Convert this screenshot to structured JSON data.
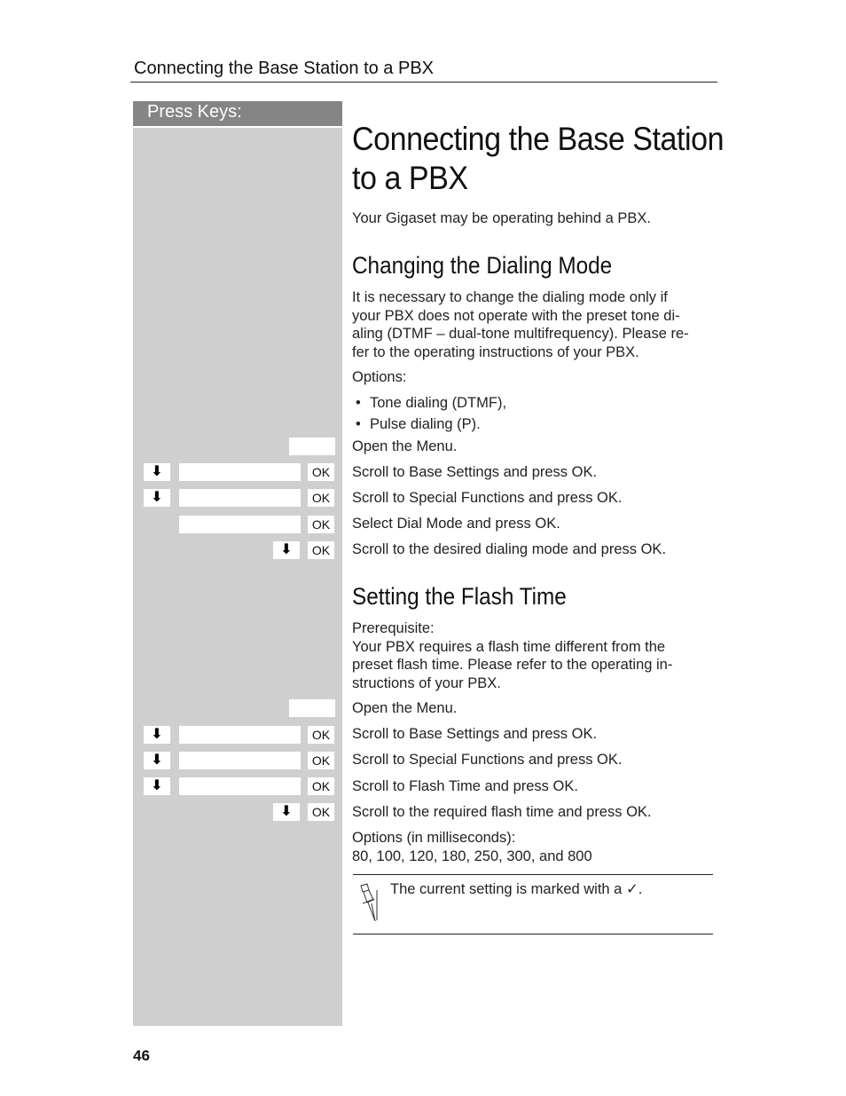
{
  "running_header": "Connecting the Base Station to a PBX",
  "press_keys_label": "Press Keys:",
  "title_line1": "Connecting the Base Station",
  "title_line2": "to a PBX",
  "intro": "Your Gigaset may be operating behind a PBX.",
  "section1": {
    "heading": "Changing the Dialing Mode",
    "body": [
      "It is necessary to change the dialing mode only if",
      "your PBX does not operate with the preset tone di-",
      "aling (DTMF – dual-tone multifrequency). Please re-",
      "fer to the operating instructions of your PBX."
    ],
    "options_label": "Options:",
    "options": [
      "Tone dialing (DTMF),",
      "Pulse dialing (P)."
    ],
    "steps": [
      {
        "keys": [
          "menu"
        ],
        "text": "Open the Menu."
      },
      {
        "keys": [
          "arrow-down",
          "display",
          "ok"
        ],
        "text": "Scroll to Base Settings and press OK."
      },
      {
        "keys": [
          "arrow-down",
          "display",
          "ok"
        ],
        "text": "Scroll to Special Functions and press OK."
      },
      {
        "keys": [
          "display",
          "ok"
        ],
        "text": "Select Dial Mode and press OK."
      },
      {
        "keys": [
          "arrow-down",
          "ok"
        ],
        "text": "Scroll to the desired dialing mode and press OK."
      }
    ]
  },
  "section2": {
    "heading": "Setting the Flash Time",
    "prereq_label": "Prerequisite:",
    "prereq_body": [
      "Your PBX requires a flash time different from the",
      "preset flash time. Please refer to the operating in-",
      "structions of your PBX."
    ],
    "steps": [
      {
        "keys": [
          "menu"
        ],
        "text": "Open the Menu."
      },
      {
        "keys": [
          "arrow-down",
          "display",
          "ok"
        ],
        "text": "Scroll to Base Settings and press OK."
      },
      {
        "keys": [
          "arrow-down",
          "display",
          "ok"
        ],
        "text": "Scroll to Special Functions and press OK."
      },
      {
        "keys": [
          "arrow-down",
          "display",
          "ok"
        ],
        "text": "Scroll to Flash Time and press OK."
      },
      {
        "keys": [
          "arrow-down",
          "ok"
        ],
        "text": "Scroll to the required flash time and press OK."
      }
    ],
    "options_label": "Options (in milliseconds):",
    "options_values": "80, 100, 120, 180, 250, 300, and 800"
  },
  "hint": {
    "icon": "pushpin-icon",
    "text": "The current setting is marked with a ✓."
  },
  "keys": {
    "ok_label": "OK",
    "arrow_glyph": "⬇"
  },
  "page_number": "46"
}
